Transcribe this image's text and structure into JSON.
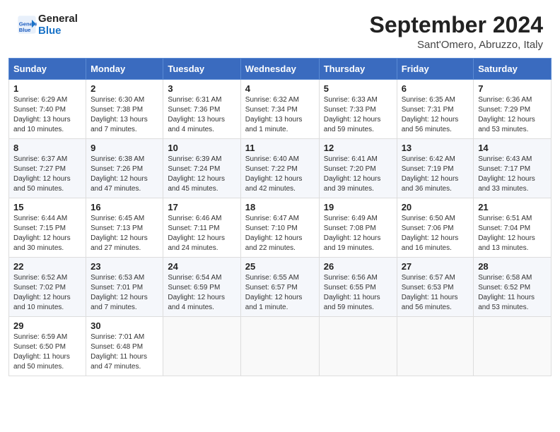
{
  "header": {
    "logo_line1": "General",
    "logo_line2": "Blue",
    "month": "September 2024",
    "location": "Sant'Omero, Abruzzo, Italy"
  },
  "weekdays": [
    "Sunday",
    "Monday",
    "Tuesday",
    "Wednesday",
    "Thursday",
    "Friday",
    "Saturday"
  ],
  "weeks": [
    [
      {
        "day": "1",
        "rise": "6:29 AM",
        "set": "7:40 PM",
        "daylight": "13 hours and 10 minutes."
      },
      {
        "day": "2",
        "rise": "6:30 AM",
        "set": "7:38 PM",
        "daylight": "13 hours and 7 minutes."
      },
      {
        "day": "3",
        "rise": "6:31 AM",
        "set": "7:36 PM",
        "daylight": "13 hours and 4 minutes."
      },
      {
        "day": "4",
        "rise": "6:32 AM",
        "set": "7:34 PM",
        "daylight": "13 hours and 1 minute."
      },
      {
        "day": "5",
        "rise": "6:33 AM",
        "set": "7:33 PM",
        "daylight": "12 hours and 59 minutes."
      },
      {
        "day": "6",
        "rise": "6:35 AM",
        "set": "7:31 PM",
        "daylight": "12 hours and 56 minutes."
      },
      {
        "day": "7",
        "rise": "6:36 AM",
        "set": "7:29 PM",
        "daylight": "12 hours and 53 minutes."
      }
    ],
    [
      {
        "day": "8",
        "rise": "6:37 AM",
        "set": "7:27 PM",
        "daylight": "12 hours and 50 minutes."
      },
      {
        "day": "9",
        "rise": "6:38 AM",
        "set": "7:26 PM",
        "daylight": "12 hours and 47 minutes."
      },
      {
        "day": "10",
        "rise": "6:39 AM",
        "set": "7:24 PM",
        "daylight": "12 hours and 45 minutes."
      },
      {
        "day": "11",
        "rise": "6:40 AM",
        "set": "7:22 PM",
        "daylight": "12 hours and 42 minutes."
      },
      {
        "day": "12",
        "rise": "6:41 AM",
        "set": "7:20 PM",
        "daylight": "12 hours and 39 minutes."
      },
      {
        "day": "13",
        "rise": "6:42 AM",
        "set": "7:19 PM",
        "daylight": "12 hours and 36 minutes."
      },
      {
        "day": "14",
        "rise": "6:43 AM",
        "set": "7:17 PM",
        "daylight": "12 hours and 33 minutes."
      }
    ],
    [
      {
        "day": "15",
        "rise": "6:44 AM",
        "set": "7:15 PM",
        "daylight": "12 hours and 30 minutes."
      },
      {
        "day": "16",
        "rise": "6:45 AM",
        "set": "7:13 PM",
        "daylight": "12 hours and 27 minutes."
      },
      {
        "day": "17",
        "rise": "6:46 AM",
        "set": "7:11 PM",
        "daylight": "12 hours and 24 minutes."
      },
      {
        "day": "18",
        "rise": "6:47 AM",
        "set": "7:10 PM",
        "daylight": "12 hours and 22 minutes."
      },
      {
        "day": "19",
        "rise": "6:49 AM",
        "set": "7:08 PM",
        "daylight": "12 hours and 19 minutes."
      },
      {
        "day": "20",
        "rise": "6:50 AM",
        "set": "7:06 PM",
        "daylight": "12 hours and 16 minutes."
      },
      {
        "day": "21",
        "rise": "6:51 AM",
        "set": "7:04 PM",
        "daylight": "12 hours and 13 minutes."
      }
    ],
    [
      {
        "day": "22",
        "rise": "6:52 AM",
        "set": "7:02 PM",
        "daylight": "12 hours and 10 minutes."
      },
      {
        "day": "23",
        "rise": "6:53 AM",
        "set": "7:01 PM",
        "daylight": "12 hours and 7 minutes."
      },
      {
        "day": "24",
        "rise": "6:54 AM",
        "set": "6:59 PM",
        "daylight": "12 hours and 4 minutes."
      },
      {
        "day": "25",
        "rise": "6:55 AM",
        "set": "6:57 PM",
        "daylight": "12 hours and 1 minute."
      },
      {
        "day": "26",
        "rise": "6:56 AM",
        "set": "6:55 PM",
        "daylight": "11 hours and 59 minutes."
      },
      {
        "day": "27",
        "rise": "6:57 AM",
        "set": "6:53 PM",
        "daylight": "11 hours and 56 minutes."
      },
      {
        "day": "28",
        "rise": "6:58 AM",
        "set": "6:52 PM",
        "daylight": "11 hours and 53 minutes."
      }
    ],
    [
      {
        "day": "29",
        "rise": "6:59 AM",
        "set": "6:50 PM",
        "daylight": "11 hours and 50 minutes."
      },
      {
        "day": "30",
        "rise": "7:01 AM",
        "set": "6:48 PM",
        "daylight": "11 hours and 47 minutes."
      },
      null,
      null,
      null,
      null,
      null
    ]
  ],
  "labels": {
    "sunrise": "Sunrise:",
    "sunset": "Sunset:",
    "daylight": "Daylight:"
  }
}
